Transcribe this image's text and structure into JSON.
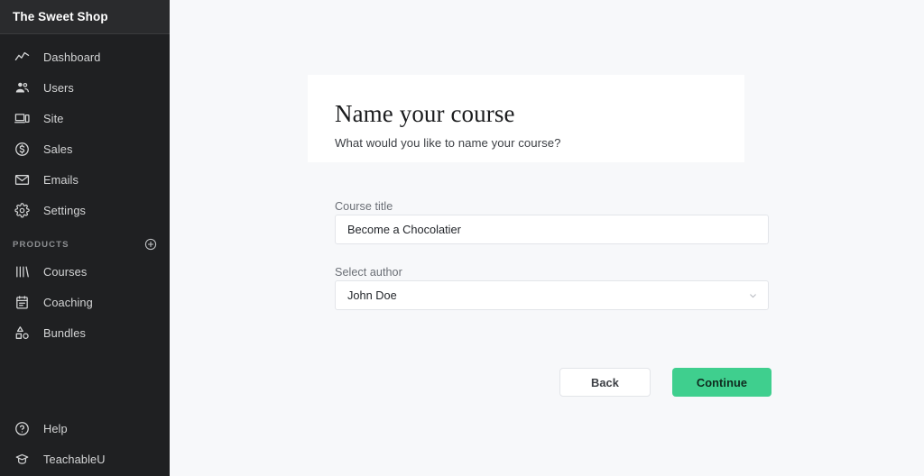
{
  "sidebar": {
    "brand": "The Sweet Shop",
    "main_items": [
      {
        "label": "Dashboard",
        "icon": "line-chart-icon"
      },
      {
        "label": "Users",
        "icon": "users-icon"
      },
      {
        "label": "Site",
        "icon": "devices-icon"
      },
      {
        "label": "Sales",
        "icon": "dollar-circle-icon"
      },
      {
        "label": "Emails",
        "icon": "envelope-icon"
      },
      {
        "label": "Settings",
        "icon": "gear-icon"
      }
    ],
    "products_section": {
      "title": "PRODUCTS",
      "add_icon": "plus-circle-icon",
      "items": [
        {
          "label": "Courses",
          "icon": "books-icon"
        },
        {
          "label": "Coaching",
          "icon": "clipboard-icon"
        },
        {
          "label": "Bundles",
          "icon": "shapes-icon"
        }
      ]
    },
    "bottom_items": [
      {
        "label": "Help",
        "icon": "question-circle-icon"
      },
      {
        "label": "TeachableU",
        "icon": "graduation-cap-icon"
      }
    ]
  },
  "card": {
    "title": "Name your course",
    "subtitle": "What would you like to name your course?"
  },
  "form": {
    "course_title": {
      "label": "Course title",
      "value": "Become a Chocolatier",
      "placeholder": "Course title"
    },
    "select_author": {
      "label": "Select author",
      "value": "John Doe",
      "chevron_icon": "chevron-down-icon"
    }
  },
  "actions": {
    "back_label": "Back",
    "continue_label": "Continue"
  },
  "colors": {
    "accent_green": "#3fcf8e",
    "sidebar_bg": "#1f2022",
    "sidebar_header_bg": "#2a2b2d",
    "main_bg": "#f7f8fa",
    "card_bg": "#ffffff",
    "border": "#e3e5e9"
  }
}
